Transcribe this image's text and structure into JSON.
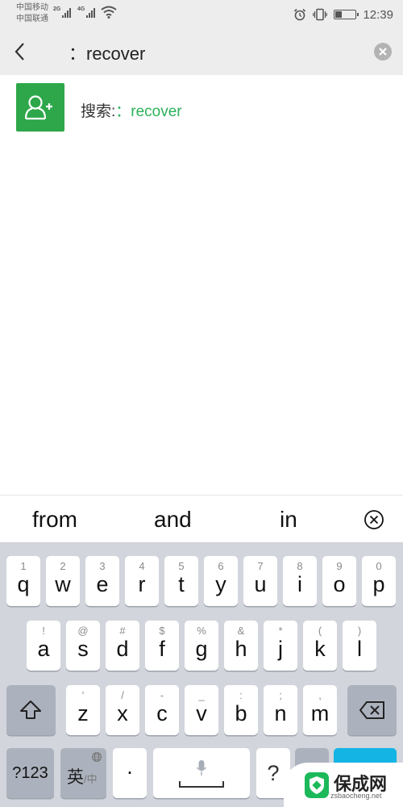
{
  "status_bar": {
    "carrier_1": "中国移动",
    "carrier_2": "中国联通",
    "sim1_network": "2G",
    "sim2_network": "4G",
    "time": "12:39",
    "battery_level": 0.3,
    "icons": [
      "signal-icon",
      "wifi-icon",
      "alarm-icon",
      "vibrate-icon",
      "battery-icon"
    ]
  },
  "search_bar": {
    "back_icon": "chevron-left-icon",
    "query": "：recover",
    "clear_icon": "clear-circle-icon"
  },
  "results": [
    {
      "icon": "add-contact-icon",
      "label": "搜索:",
      "query": "：recover",
      "accent_color": "#2ea74a"
    }
  ],
  "suggestions": {
    "words": [
      "from",
      "and",
      "in"
    ],
    "close_icon": "circle-x-icon"
  },
  "keyboard": {
    "row1": [
      {
        "main": "q",
        "sub": "1"
      },
      {
        "main": "w",
        "sub": "2"
      },
      {
        "main": "e",
        "sub": "3"
      },
      {
        "main": "r",
        "sub": "4"
      },
      {
        "main": "t",
        "sub": "5"
      },
      {
        "main": "y",
        "sub": "6"
      },
      {
        "main": "u",
        "sub": "7"
      },
      {
        "main": "i",
        "sub": "8"
      },
      {
        "main": "o",
        "sub": "9"
      },
      {
        "main": "p",
        "sub": "0"
      }
    ],
    "row2": [
      {
        "main": "a",
        "sub": "!"
      },
      {
        "main": "s",
        "sub": "@"
      },
      {
        "main": "d",
        "sub": "#"
      },
      {
        "main": "f",
        "sub": "$"
      },
      {
        "main": "g",
        "sub": "%"
      },
      {
        "main": "h",
        "sub": "&"
      },
      {
        "main": "j",
        "sub": "*"
      },
      {
        "main": "k",
        "sub": "("
      },
      {
        "main": "l",
        "sub": ")"
      }
    ],
    "row3": [
      {
        "main": "z",
        "sub": "'"
      },
      {
        "main": "x",
        "sub": "/"
      },
      {
        "main": "c",
        "sub": "-"
      },
      {
        "main": "v",
        "sub": "_"
      },
      {
        "main": "b",
        "sub": ":"
      },
      {
        "main": "n",
        "sub": ";"
      },
      {
        "main": "m",
        "sub": ","
      }
    ],
    "shift_icon": "shift-arrow-icon",
    "backspace_icon": "backspace-icon",
    "num_label": "?123",
    "lang_main": "英",
    "lang_sub": "/中",
    "lang_icon": "globe-icon",
    "dot_label": "·",
    "space_icon": "microphone-icon",
    "question_label": "?",
    "emoji_icon": "emoji-icon",
    "enter_color": "#14b4e4"
  },
  "watermark": {
    "text": "保成网",
    "url_text": "zsbaocheng.net"
  }
}
